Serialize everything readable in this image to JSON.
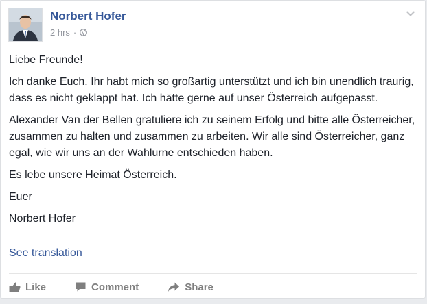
{
  "post": {
    "author": "Norbert Hofer",
    "time": "2 hrs",
    "separator": "·",
    "paragraphs": [
      "Liebe Freunde!",
      "Ich danke Euch. Ihr habt mich so großartig unterstützt und ich bin unendlich traurig, dass es nicht geklappt hat. Ich hätte gerne auf unser Österreich aufgepasst.",
      "Alexander Van der Bellen gratuliere ich zu seinem Erfolg und bitte alle Österreicher, zusammen zu halten und zusammen zu arbeiten. Wir alle sind Österreicher, ganz egal, wie wir uns an der Wahlurne entschieden haben.",
      "Es lebe unsere Heimat Österreich.",
      "Euer",
      "Norbert Hofer"
    ],
    "see_translation": "See translation",
    "privacy_icon": "globe-icon",
    "menu_icon": "chevron-down-icon"
  },
  "actions": {
    "like": "Like",
    "comment": "Comment",
    "share": "Share"
  },
  "colors": {
    "link": "#365899",
    "text": "#1d2129",
    "muted": "#90949c",
    "action": "#7f7f7f",
    "background": "#e9ebee"
  }
}
